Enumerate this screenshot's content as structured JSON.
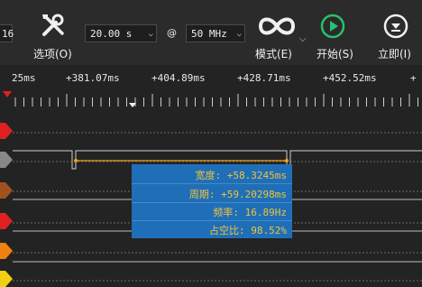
{
  "toolbar": {
    "channel_select_value": "16",
    "options_label": "选项(O)",
    "samples_select_value": "20.00 s",
    "at_symbol": "@",
    "rate_select_value": "50 MHz",
    "mode_label": "模式(E)",
    "start_label": "开始(S)",
    "immediate_label": "立即(I)"
  },
  "timeline": {
    "labels": [
      "25ms",
      "+381.07ms",
      "+404.89ms",
      "+428.71ms",
      "+452.52ms",
      "+"
    ]
  },
  "measurement": {
    "width": "宽度: +58.3245ms",
    "period": "周期: +59.20298ms",
    "frequency": "频率: 16.89Hz",
    "duty_cycle": "占空比: 98.52%"
  },
  "colors": {
    "background": "#232323",
    "toolbar": "#2b2b2b",
    "tooltip": "#1f6fb8",
    "tooltip_text": "#f2c33a",
    "start_green": "#27c26b",
    "selection_line": "#f0a020"
  },
  "channels": [
    {
      "color": "#e02020"
    },
    {
      "color": "#888888"
    },
    {
      "color": "#a0521e"
    },
    {
      "color": "#e02020"
    },
    {
      "color": "#f08010"
    },
    {
      "color": "#f0d010"
    }
  ]
}
